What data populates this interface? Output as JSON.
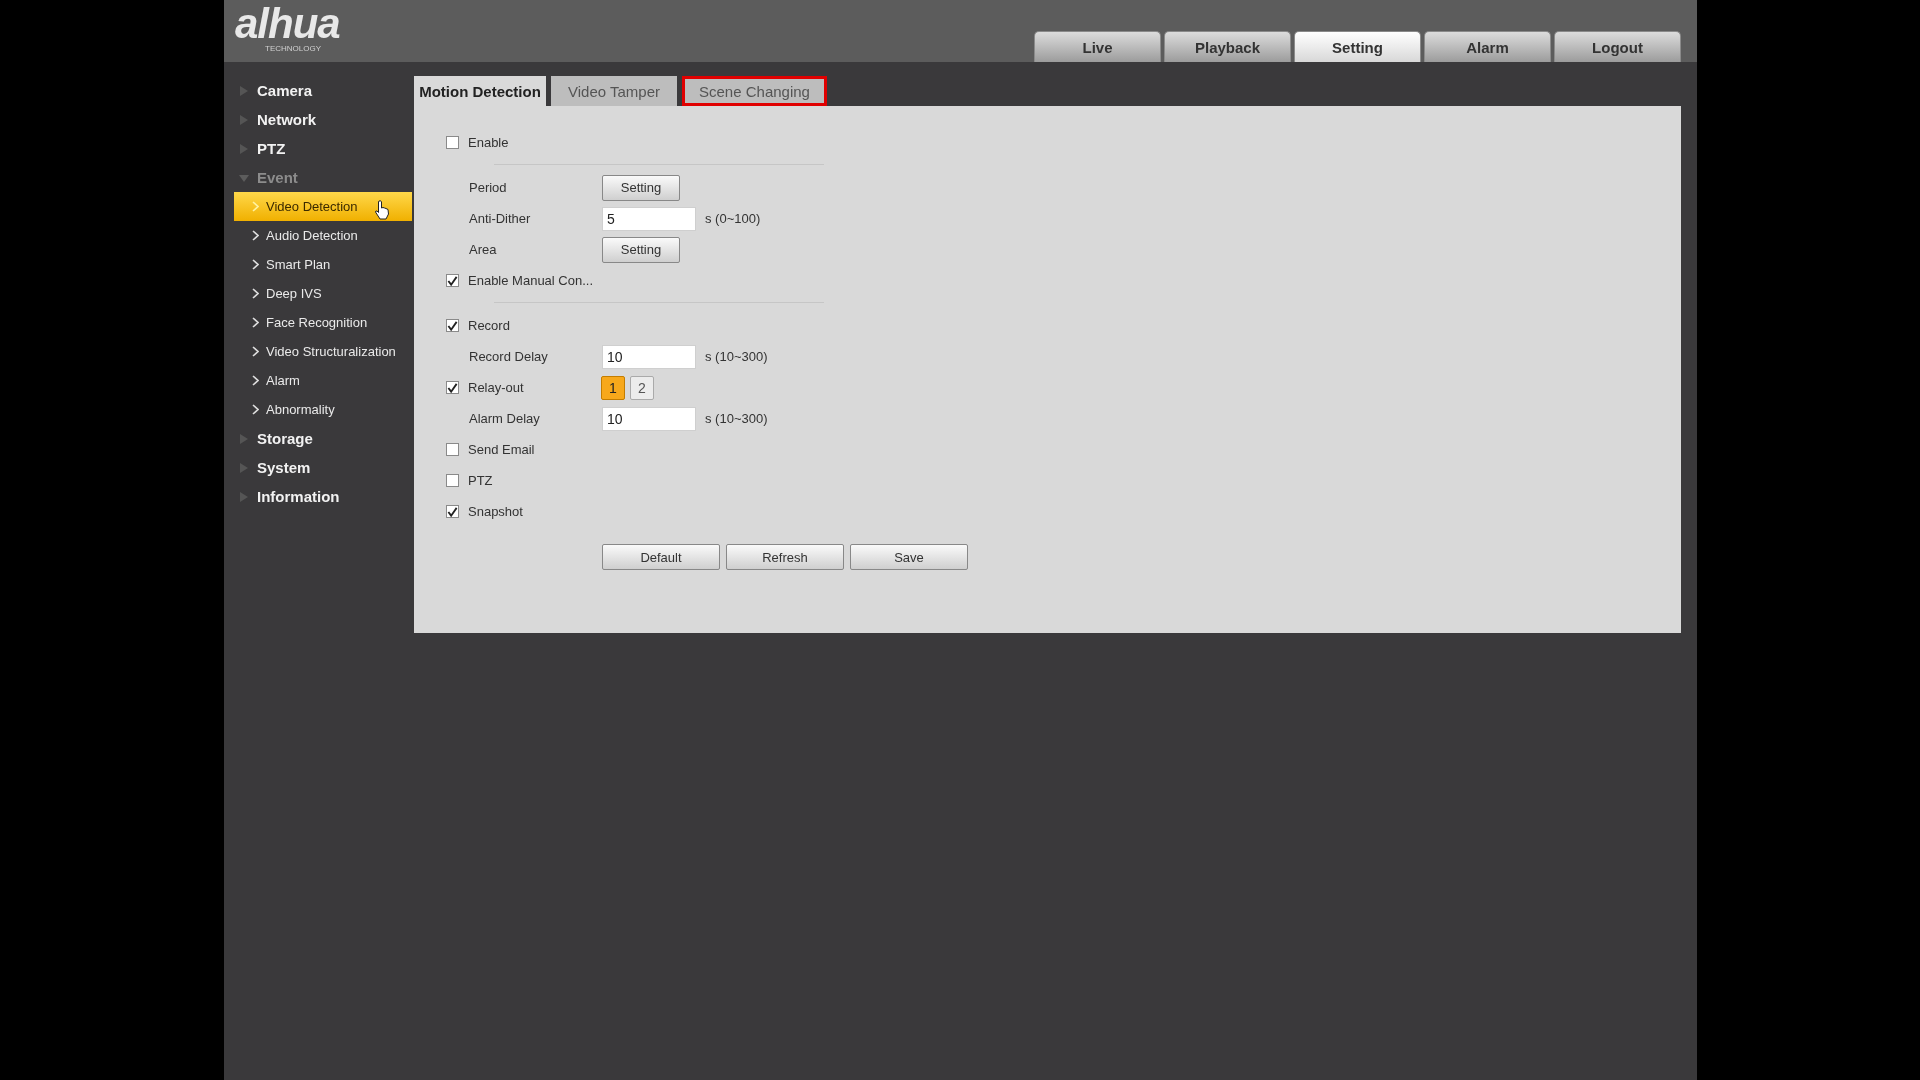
{
  "header": {
    "logo": {
      "name": "alhua",
      "tagline": "TECHNOLOGY"
    },
    "nav": [
      {
        "label": "Live",
        "selected": false
      },
      {
        "label": "Playback",
        "selected": false
      },
      {
        "label": "Setting",
        "selected": true
      },
      {
        "label": "Alarm",
        "selected": false
      },
      {
        "label": "Logout",
        "selected": false
      }
    ]
  },
  "sidebar": {
    "items": [
      {
        "label": "Camera",
        "expanded": false
      },
      {
        "label": "Network",
        "expanded": false
      },
      {
        "label": "PTZ",
        "expanded": false
      },
      {
        "label": "Event",
        "expanded": true,
        "children": [
          {
            "label": "Video Detection",
            "selected": true
          },
          {
            "label": "Audio Detection",
            "selected": false
          },
          {
            "label": "Smart Plan",
            "selected": false
          },
          {
            "label": "Deep IVS",
            "selected": false
          },
          {
            "label": "Face Recognition",
            "selected": false
          },
          {
            "label": "Video Structuralization",
            "selected": false
          },
          {
            "label": "Alarm",
            "selected": false
          },
          {
            "label": "Abnormality",
            "selected": false
          }
        ]
      },
      {
        "label": "Storage",
        "expanded": false
      },
      {
        "label": "System",
        "expanded": false
      },
      {
        "label": "Information",
        "expanded": false
      }
    ]
  },
  "tabs": [
    {
      "label": "Motion Detection",
      "selected": true,
      "highlighted": false
    },
    {
      "label": "Video Tamper",
      "selected": false,
      "highlighted": false
    },
    {
      "label": "Scene Changing",
      "selected": false,
      "highlighted": true
    }
  ],
  "form": {
    "rows": [
      {
        "kind": "checkbox",
        "label": "Enable",
        "checked": false
      },
      {
        "kind": "divider"
      },
      {
        "kind": "button",
        "label": "Period",
        "button": "Setting"
      },
      {
        "kind": "input",
        "label": "Anti-Dither",
        "value": "5",
        "unit": "s (0~100)"
      },
      {
        "kind": "button",
        "label": "Area",
        "button": "Setting"
      },
      {
        "kind": "checkbox",
        "label": "Enable Manual Con...",
        "checked": true
      },
      {
        "kind": "divider"
      },
      {
        "kind": "checkbox",
        "label": "Record",
        "checked": true
      },
      {
        "kind": "input",
        "label": "Record Delay",
        "value": "10",
        "unit": "s (10~300)"
      },
      {
        "kind": "relay",
        "label": "Relay-out",
        "checked": true,
        "channels": [
          {
            "label": "1",
            "selected": true
          },
          {
            "label": "2",
            "selected": false
          }
        ]
      },
      {
        "kind": "input",
        "label": "Alarm Delay",
        "value": "10",
        "unit": "s (10~300)"
      },
      {
        "kind": "checkbox",
        "label": "Send Email",
        "checked": false
      },
      {
        "kind": "checkbox",
        "label": "PTZ",
        "checked": false
      },
      {
        "kind": "checkbox",
        "label": "Snapshot",
        "checked": true
      }
    ],
    "actions": [
      "Default",
      "Refresh",
      "Save"
    ]
  }
}
